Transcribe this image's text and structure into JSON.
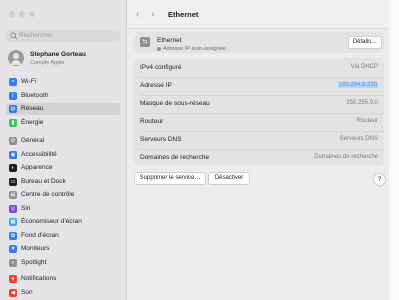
{
  "sidebar": {
    "search_placeholder": "Rechercher",
    "account": {
      "name": "Stephane Gorteau",
      "subtitle": "Compte Apple"
    },
    "groups": [
      [
        {
          "label": "Wi‑Fi",
          "icon": "wifi-icon",
          "color": "#2f7cf6",
          "glyph": "≈"
        },
        {
          "label": "Bluetooth",
          "icon": "bluetooth-icon",
          "color": "#2f7cf6",
          "glyph": "ᛒ"
        },
        {
          "label": "Réseau",
          "icon": "globe-icon",
          "color": "#2f7cf6",
          "glyph": "◍",
          "selected": true
        },
        {
          "label": "Énergie",
          "icon": "battery-icon",
          "color": "#34c759",
          "glyph": "▮"
        }
      ],
      [
        {
          "label": "Général",
          "icon": "gear-icon",
          "color": "#8e8e93",
          "glyph": "⚙"
        },
        {
          "label": "Accessibilité",
          "icon": "accessibility-icon",
          "color": "#2f7cf6",
          "glyph": "◉"
        },
        {
          "label": "Apparence",
          "icon": "appearance-icon",
          "color": "#1d1d1f",
          "glyph": "◐"
        },
        {
          "label": "Bureau et Dock",
          "icon": "dock-icon",
          "color": "#1d1d1f",
          "glyph": "▭"
        },
        {
          "label": "Centre de contrôle",
          "icon": "control-center-icon",
          "color": "#8e8e93",
          "glyph": "▤"
        },
        {
          "label": "Siri",
          "icon": "siri-icon",
          "color": "#6e4ae0",
          "glyph": "◎"
        },
        {
          "label": "Économiseur d'écran",
          "icon": "screensaver-icon",
          "color": "#2fb0d6",
          "glyph": "▦"
        },
        {
          "label": "Fond d'écran",
          "icon": "wallpaper-icon",
          "color": "#2f7cf6",
          "glyph": "✿"
        },
        {
          "label": "Moniteurs",
          "icon": "display-icon",
          "color": "#2f7cf6",
          "glyph": "✷"
        },
        {
          "label": "Spotlight",
          "icon": "spotlight-icon",
          "color": "#8e8e93",
          "glyph": "⌕"
        }
      ],
      [
        {
          "label": "Notifications",
          "icon": "notifications-icon",
          "color": "#ff3b30",
          "glyph": "●"
        },
        {
          "label": "Son",
          "icon": "sound-icon",
          "color": "#ff3b30",
          "glyph": "◀"
        }
      ]
    ]
  },
  "header": {
    "back_icon": "chevron-left-icon",
    "forward_icon": "chevron-right-icon",
    "title": "Ethernet"
  },
  "service": {
    "name": "Ethernet",
    "status": "Adresse IP auto-assignée",
    "details_label": "Détails…"
  },
  "details": [
    {
      "key": "IPv4 configuré",
      "value": "Via DHCP"
    },
    {
      "key": "Adresse IP",
      "value": "169.254.8.230",
      "highlight": true
    },
    {
      "key": "Masque de sous-réseau",
      "value": "255.255.0.0"
    },
    {
      "key": "Routeur",
      "value": "Routeur"
    },
    {
      "key": "Serveurs DNS",
      "value": "Serveurs DNS"
    },
    {
      "key": "Domaines de recherche",
      "value": "Domaines de recherche"
    }
  ],
  "actions": {
    "remove_label": "Supprimer le service…",
    "deactivate_label": "Désactiver",
    "help_label": "?"
  }
}
